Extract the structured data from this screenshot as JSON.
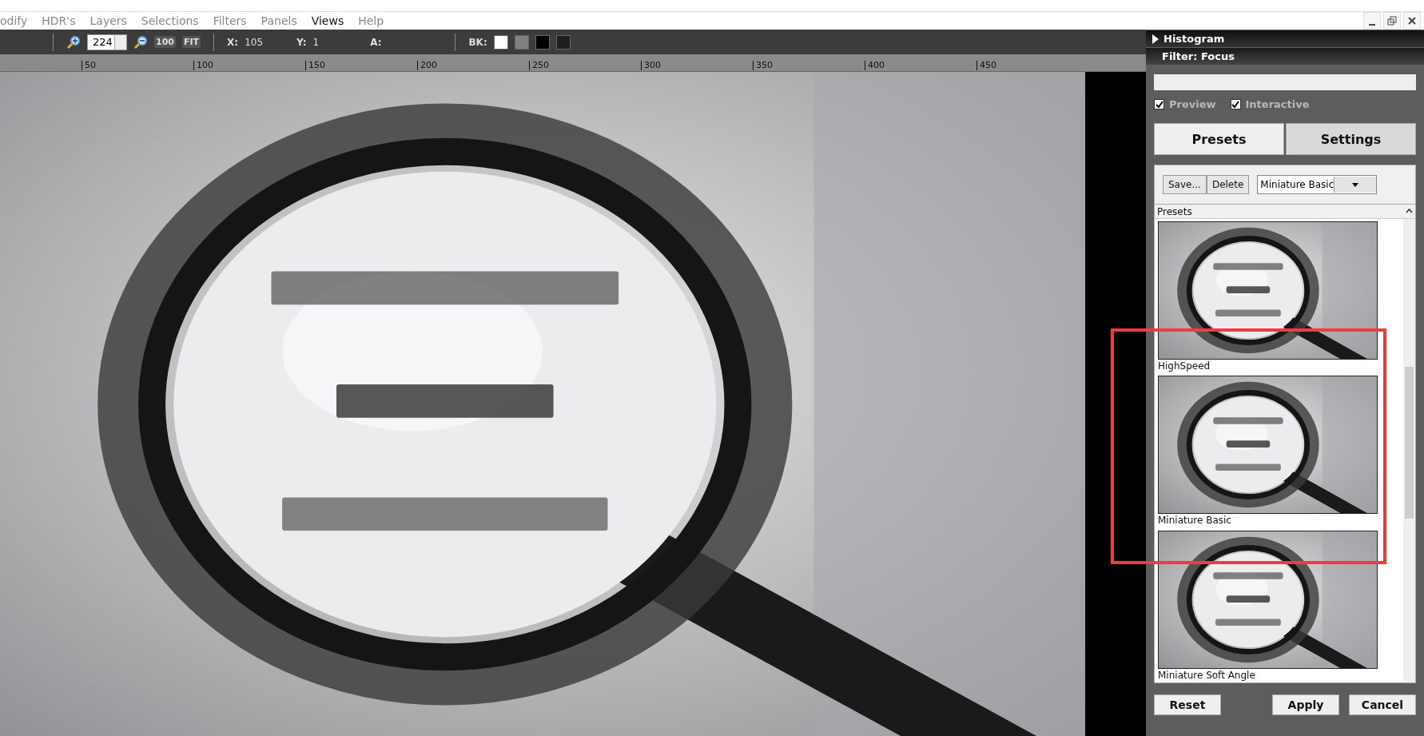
{
  "menu": [
    {
      "label": "odify",
      "selected": false
    },
    {
      "label": "HDR's",
      "selected": false
    },
    {
      "label": "Layers",
      "selected": false
    },
    {
      "label": "Selections",
      "selected": false
    },
    {
      "label": "Filters",
      "selected": false
    },
    {
      "label": "Panels",
      "selected": false
    },
    {
      "label": "Views",
      "selected": true
    },
    {
      "label": "Help",
      "selected": false
    }
  ],
  "toolbar": {
    "zoom": "224",
    "zoom_100": "100",
    "zoom_fit": "FIT",
    "x_label": "X:",
    "x_value": "105",
    "y_label": "Y:",
    "y_value": "1",
    "a_label": "A:",
    "bk_label": "BK:",
    "bk_swatches": [
      {
        "color": "#ffffff"
      },
      {
        "color": "#808080"
      },
      {
        "color": "#000000"
      },
      {
        "color": "#1e1e1e"
      }
    ]
  },
  "ruler": [
    "50",
    "100",
    "150",
    "200",
    "250",
    "300",
    "350",
    "400",
    "450"
  ],
  "panel": {
    "histogram": "Histogram",
    "filter_title": "Filter: Focus",
    "checks": [
      {
        "label": "Preview",
        "checked": true
      },
      {
        "label": "Interactive",
        "checked": true
      }
    ],
    "tabs": [
      {
        "label": "Presets",
        "selected": true
      },
      {
        "label": "Settings",
        "selected": false
      }
    ],
    "save": "Save...",
    "delete": "Delete",
    "preset_select": "Miniature Basic",
    "list_header": "Presets",
    "presets": [
      {
        "label": "HighSpeed",
        "kind": "picture"
      },
      {
        "label": "Miniature Basic",
        "kind": "picture"
      },
      {
        "label": "Miniature Soft Angle",
        "kind": "picture"
      }
    ],
    "buttons": [
      "Reset",
      "Apply",
      "Cancel"
    ]
  }
}
